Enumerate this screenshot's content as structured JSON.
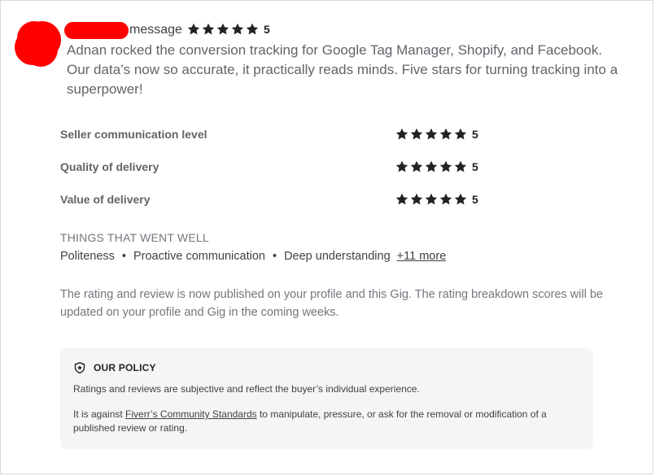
{
  "review": {
    "message_label": "message",
    "rating": "5",
    "text": "Adnan rocked the conversion tracking for Google Tag Manager, Shopify, and Facebook. Our data’s now so accurate, it practically reads minds. Five stars for turning tracking into a superpower!"
  },
  "breakdown": [
    {
      "label": "Seller communication level",
      "score": "5"
    },
    {
      "label": "Quality of delivery",
      "score": "5"
    },
    {
      "label": "Value of delivery",
      "score": "5"
    }
  ],
  "went_well": {
    "title": "THINGS THAT WENT WELL",
    "tags": [
      "Politeness",
      "Proactive communication",
      "Deep understanding"
    ],
    "separator": "•",
    "more_link": "+11 more"
  },
  "notice": "The rating and review is now published on your profile and this Gig. The rating breakdown scores will be updated on your profile and Gig in the coming weeks.",
  "policy": {
    "title": "OUR POLICY",
    "icon": "shield-star-icon",
    "p1": "Ratings and reviews are subjective and reflect the buyer’s individual experience.",
    "p2_before": "It is against ",
    "p2_link": "Fiverr’s Community Standards",
    "p2_after": " to manipulate, pressure, or ask for the removal or modification of a published review or rating."
  },
  "colors": {
    "star": "#222325",
    "redaction": "#ff0000",
    "policy_bg": "#f5f5f5"
  }
}
